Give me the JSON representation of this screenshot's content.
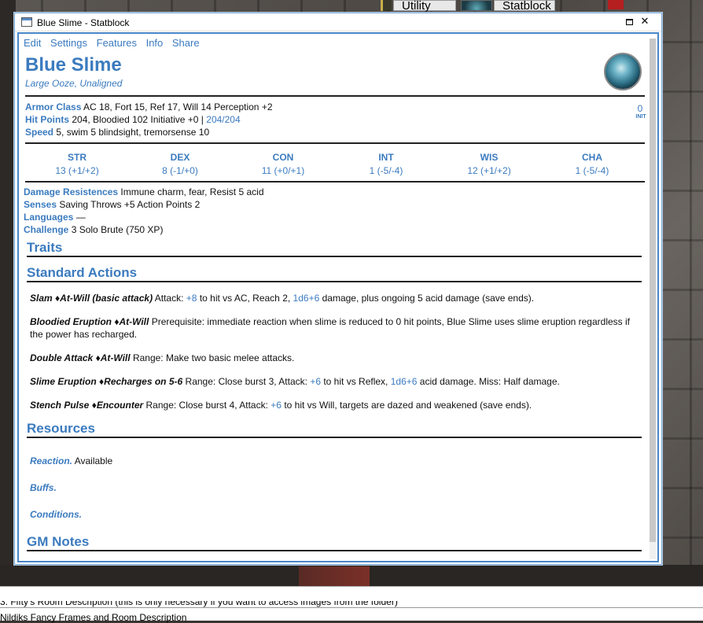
{
  "top_tabs": {
    "utility": "Utility",
    "statblock": "Statblock"
  },
  "window": {
    "title": "Blue Slime - Statblock",
    "close_glyph": "✕"
  },
  "menu": [
    "Edit",
    "Settings",
    "Features",
    "Info",
    "Share"
  ],
  "creature": {
    "name": "Blue Slime",
    "size_type": "Large Ooze",
    "alignment": "Unaligned"
  },
  "defense": {
    "ac_label": "Armor Class",
    "ac_text": "AC 18, Fort 15, Ref 17, Will 14 Perception +2",
    "hp_label": "Hit Points",
    "hp_text": "204, Bloodied 102 Initiative +0 |",
    "hp_current": "204/204",
    "speed_label": "Speed",
    "speed_text": "5, swim 5 blindsight, tremorsense 10",
    "init_value": "0",
    "init_label": "INIT"
  },
  "abilities": [
    {
      "name": "STR",
      "value": "13 (+1/+2)"
    },
    {
      "name": "DEX",
      "value": "8 (-1/+0)"
    },
    {
      "name": "CON",
      "value": "11 (+0/+1)"
    },
    {
      "name": "INT",
      "value": "1 (-5/-4)"
    },
    {
      "name": "WIS",
      "value": "12 (+1/+2)"
    },
    {
      "name": "CHA",
      "value": "1 (-5/-4)"
    }
  ],
  "details": {
    "dr_label": "Damage Resistences",
    "dr_text": "Immune charm, fear, Resist 5 acid",
    "senses_label": "Senses",
    "senses_text": "Saving Throws +5 Action Points 2",
    "lang_label": "Languages",
    "lang_text": "—",
    "challenge_label": "Challenge",
    "challenge_text": "3 Solo Brute (750 XP)"
  },
  "sections": {
    "traits": "Traits",
    "standard_actions": "Standard Actions",
    "resources": "Resources",
    "gm_notes": "GM Notes"
  },
  "powers": {
    "slam": {
      "name": "Slam",
      "usage": "At-Will (basic attack)",
      "pre": "Attack:",
      "bonus": "+8",
      "mid": "to hit vs AC, Reach 2,",
      "dice": "1d6+6",
      "post": "damage, plus ongoing 5 acid damage (save ends)."
    },
    "bloodied": {
      "name": "Bloodied Eruption",
      "usage": "At-Will",
      "text": "Prerequisite: immediate reaction when slime is reduced to 0 hit points, Blue Slime uses slime eruption regardless if the power has recharged."
    },
    "double": {
      "name": "Double Attack",
      "usage": "At-Will",
      "text": "Range: Make two basic melee attacks."
    },
    "eruption": {
      "name": "Slime Eruption",
      "usage": "Recharges on 5-6",
      "pre": "Range: Close burst 3, Attack:",
      "bonus": "+6",
      "mid": "to hit vs Reflex,",
      "dice": "1d6+6",
      "post": "acid damage. Miss: Half damage."
    },
    "stench": {
      "name": "Stench Pulse",
      "usage": "Encounter",
      "pre": "Range: Close burst 4, Attack:",
      "bonus": "+6",
      "post": "to hit vs Will, targets are dazed and weakened (save ends)."
    }
  },
  "resources": {
    "reaction_label": "Reaction.",
    "reaction_value": "Available",
    "buffs_label": "Buffs.",
    "conditions_label": "Conditions."
  },
  "bottom": {
    "line1": "3. Fifty's Room Description (this is only necessary if you want to access images from the folder)",
    "line2": "Nildiks Fancy Frames and Room Description"
  },
  "colors": {
    "accent": "#3b7bbf",
    "window_border": "#4a86c8"
  }
}
